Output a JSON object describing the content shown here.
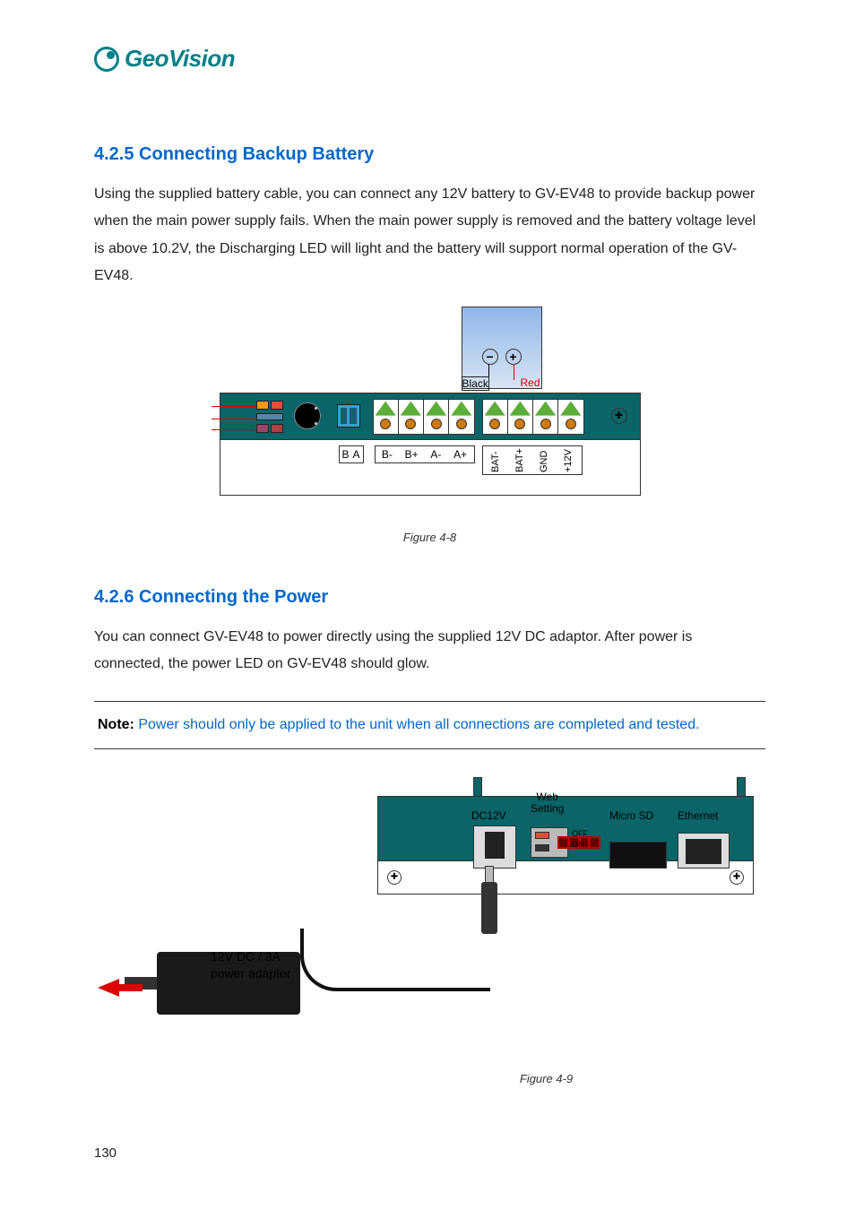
{
  "brand": "GeoVision",
  "section1": {
    "heading": "4.2.5  Connecting Backup Battery",
    "para": "Using the supplied battery cable, you can connect any 12V battery to GV-EV48 to provide backup power when the main power supply fails. When the main power supply is removed and the battery voltage level is above 10.2V, the Discharging LED will light and the battery will support normal operation of the GV-EV48.",
    "caption": "Figure 4-8"
  },
  "fig1": {
    "blackLabel": "Black",
    "redLabel": "Red",
    "dip": {
      "b": "B",
      "a": "A"
    },
    "rs485": [
      "B-",
      "B+",
      "A-",
      "A+"
    ],
    "power": [
      "BAT-",
      "BAT+",
      "GND",
      "+12V"
    ],
    "minus": "−",
    "plus": "+"
  },
  "section2": {
    "heading": "4.2.6  Connecting the Power",
    "para": "You can connect GV-EV48 to power directly using the supplied 12V DC adaptor. After power is connected, the power LED on GV-EV48 should glow.",
    "noteLabel": "Note:",
    "noteText": " Power should only be applied to the unit when all connections are completed and tested.",
    "caption": "Figure 4-9"
  },
  "fig2": {
    "dc": "DC12V",
    "web": "Web\nSetting",
    "off": "OFF",
    "on": "ON",
    "sd": "Micro SD",
    "eth": "Ethernet",
    "adaptor": "12V DC / 3A\npower adaptor"
  },
  "pageNumber": "130"
}
